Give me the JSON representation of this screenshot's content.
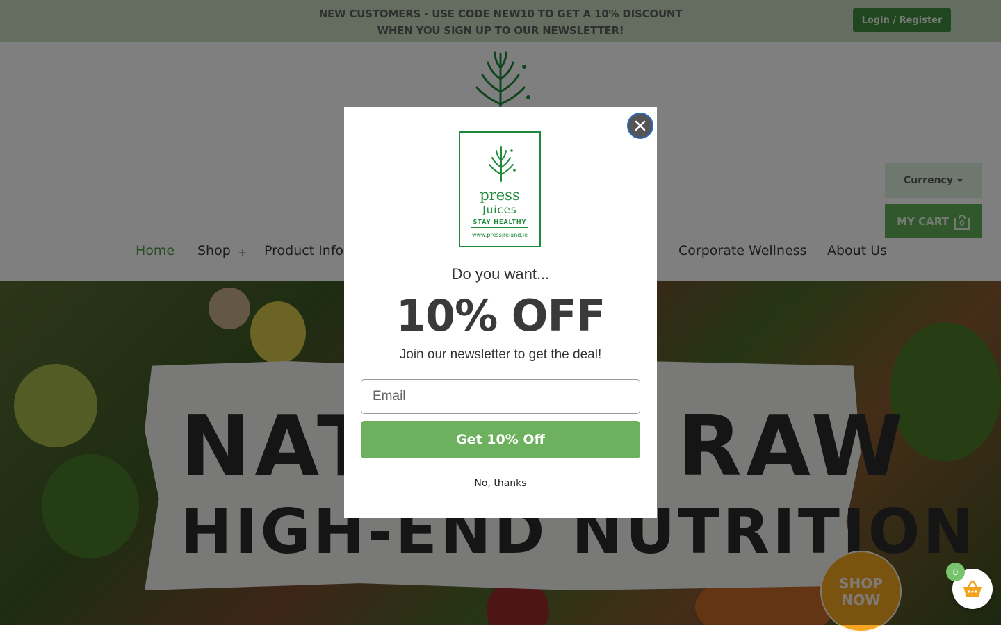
{
  "promo": {
    "line1": "NEW CUSTOMERS - USE CODE NEW10 TO GET A 10% DISCOUNT",
    "line2": "WHEN YOU SIGN UP TO OUR NEWSLETTER!",
    "login_label": "Login / Register"
  },
  "header": {
    "currency_label": "Currency",
    "cart_label": "MY CART",
    "cart_count": "0"
  },
  "nav": {
    "items": [
      "Home",
      "Shop",
      "Product Info",
      "Corporate Wellness",
      "About Us"
    ],
    "shop_plus": "+"
  },
  "hero": {
    "line1": "NATURAL RAW",
    "line2": "HIGH-END NUTRITION",
    "shop_now_line1": "SHOP",
    "shop_now_line2": "NOW"
  },
  "cart_widget": {
    "count": "0"
  },
  "popup": {
    "logo": {
      "brand": "press",
      "sub": "Juices",
      "tagline": "STAY HEALTHY",
      "url": "www.pressireland.ie"
    },
    "question": "Do you want...",
    "offer": "10% OFF",
    "subtitle": "Join our newsletter to get the deal!",
    "email_placeholder": "Email",
    "cta_label": "Get 10% Off",
    "decline_label": "No, thanks",
    "close_icon": "close-icon"
  },
  "colors": {
    "accent_green": "#6db15f",
    "brand_green": "#1f8a3b",
    "promo_bg": "#c8ddc0",
    "shop_now_orange": "#f6a623"
  }
}
